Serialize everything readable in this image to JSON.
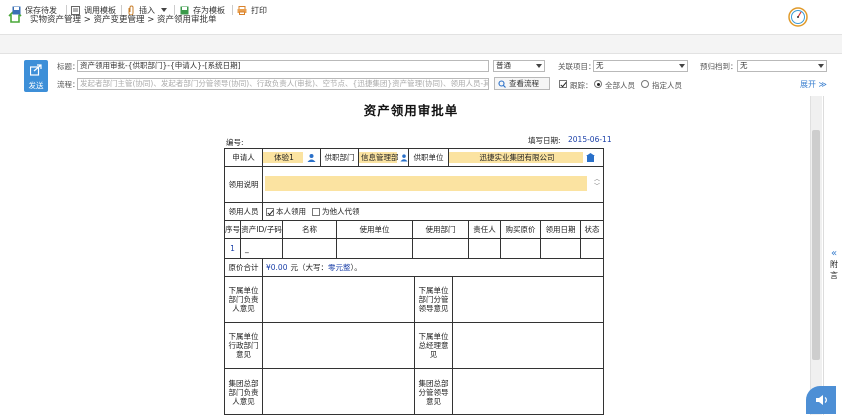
{
  "breadcrumb": {
    "text": "实物资产管理 > 资产变更管理 > 资产领用审批单"
  },
  "toolbar": {
    "save_draft": "保存待发",
    "template": "调用模板",
    "insert": "插入",
    "save_template": "存为模板",
    "print": "打印"
  },
  "header": {
    "send_label": "发送",
    "subject_label": "标题：",
    "subject_value": "资产领用审批-{供职部门}-{申请人}-[系统日期]",
    "importance_value": "普通",
    "related_label": "关联项目：",
    "related_value": "无",
    "archive_label": "预归档到：",
    "archive_value": "无",
    "flow_label": "流程：",
    "flow_placeholder": "发起者部门主管(协同)、发起者部门分管领导(协同)、行政负责人(审批)、空节点、{迅捷集团}资产管理(协同)、领用人员-其他员工(",
    "view_flow_button": "查看流程",
    "track_label": "跟踪：",
    "all_members_label": "全部人员",
    "specified_label": "指定人员",
    "expand_label": "展开"
  },
  "form": {
    "title": "资产领用审批单",
    "number_label": "编号:",
    "fill_date_label": "填写日期:",
    "fill_date_value": "2015-06-11",
    "applicant_label": "申请人",
    "applicant_value": "体验1",
    "dept_label": "供职部门",
    "dept_value": "信息管理部",
    "unit_label": "供职单位",
    "unit_value": "迅捷实业集团有限公司",
    "reason_label": "领用说明",
    "receiver_label": "领用人员",
    "self_receive": "本人领用",
    "proxy_receive": "为他人代领",
    "columns": [
      "序号",
      "资产ID/子码",
      "名称",
      "使用单位",
      "使用部门",
      "责任人",
      "购买原价",
      "领用日期",
      "状态"
    ],
    "row_index": "1",
    "row_sub": "_",
    "total_label": "原价合计",
    "total_amount": "¥0.00",
    "total_unit_text": "元（大写：",
    "total_capital": "零元整",
    "total_end": "）。",
    "opinion_1": "下属单位部门负责人意见",
    "opinion_2": "下属单位部门分管领导意见",
    "opinion_3": "下属单位行政部门意见",
    "opinion_4": "下属单位总经理意见",
    "opinion_5": "集团总部部门负责人意见",
    "opinion_6": "集团总部分管领导意见"
  },
  "side_panel": {
    "label": "附言",
    "arrow": "«"
  },
  "colors": {
    "accent": "#3d8fd8",
    "field_yellow": "#fbe3a1",
    "link_blue": "#1a3fa8"
  }
}
